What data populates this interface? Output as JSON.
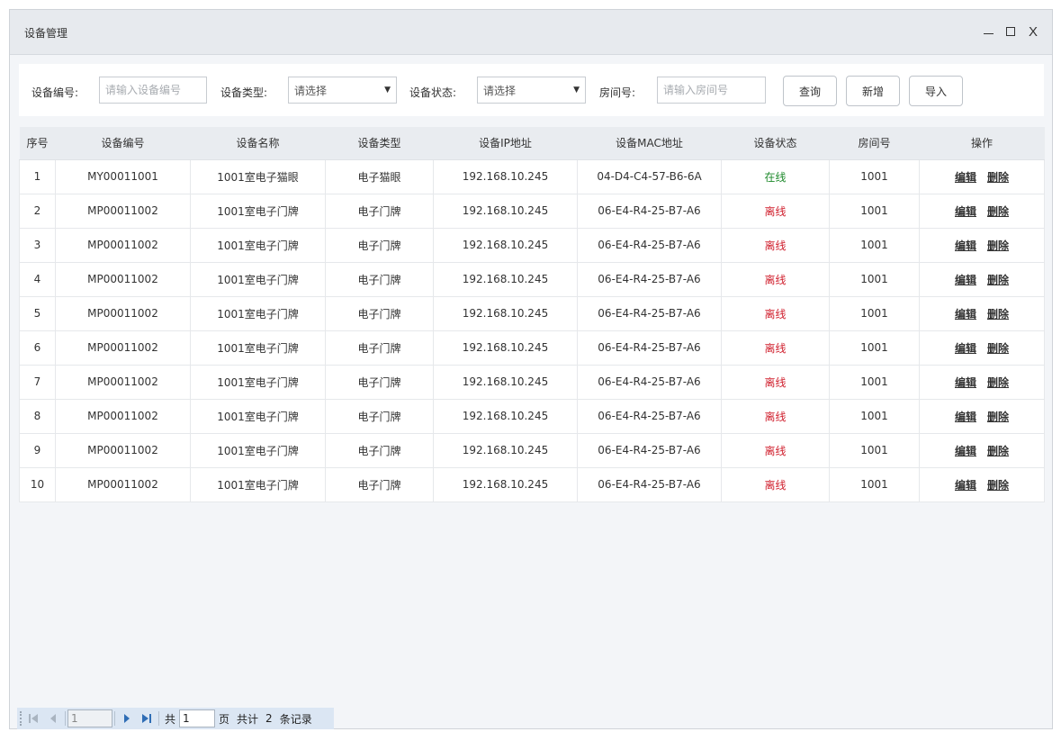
{
  "window": {
    "title": "设备管理",
    "close_label": "X"
  },
  "filters": {
    "device_no_label": "设备编号:",
    "device_no_placeholder": "请输入设备编号",
    "device_type_label": "设备类型:",
    "device_type_value": "请选择",
    "device_status_label": "设备状态:",
    "device_status_value": "请选择",
    "room_label": "房间号:",
    "room_placeholder": "请输入房间号",
    "query_button": "查询",
    "add_button": "新增",
    "import_button": "导入"
  },
  "table": {
    "headers": [
      "序号",
      "设备编号",
      "设备名称",
      "设备类型",
      "设备IP地址",
      "设备MAC地址",
      "设备状态",
      "房间号",
      "操作"
    ],
    "edit_label": "编辑",
    "delete_label": "删除",
    "rows": [
      {
        "index": "1",
        "device_no": "MY00011001",
        "name": "1001室电子猫眼",
        "type": "电子猫眼",
        "ip": "192.168.10.245",
        "mac": "04-D4-C4-57-B6-6A",
        "status": "在线",
        "status_color": "#1f8a2c",
        "room": "1001"
      },
      {
        "index": "2",
        "device_no": "MP00011002",
        "name": "1001室电子门牌",
        "type": "电子门牌",
        "ip": "192.168.10.245",
        "mac": "06-E4-R4-25-B7-A6",
        "status": "离线",
        "status_color": "#d0202e",
        "room": "1001"
      },
      {
        "index": "3",
        "device_no": "MP00011002",
        "name": "1001室电子门牌",
        "type": "电子门牌",
        "ip": "192.168.10.245",
        "mac": "06-E4-R4-25-B7-A6",
        "status": "离线",
        "status_color": "#d0202e",
        "room": "1001"
      },
      {
        "index": "4",
        "device_no": "MP00011002",
        "name": "1001室电子门牌",
        "type": "电子门牌",
        "ip": "192.168.10.245",
        "mac": "06-E4-R4-25-B7-A6",
        "status": "离线",
        "status_color": "#d0202e",
        "room": "1001"
      },
      {
        "index": "5",
        "device_no": "MP00011002",
        "name": "1001室电子门牌",
        "type": "电子门牌",
        "ip": "192.168.10.245",
        "mac": "06-E4-R4-25-B7-A6",
        "status": "离线",
        "status_color": "#d0202e",
        "room": "1001"
      },
      {
        "index": "6",
        "device_no": "MP00011002",
        "name": "1001室电子门牌",
        "type": "电子门牌",
        "ip": "192.168.10.245",
        "mac": "06-E4-R4-25-B7-A6",
        "status": "离线",
        "status_color": "#d0202e",
        "room": "1001"
      },
      {
        "index": "7",
        "device_no": "MP00011002",
        "name": "1001室电子门牌",
        "type": "电子门牌",
        "ip": "192.168.10.245",
        "mac": "06-E4-R4-25-B7-A6",
        "status": "离线",
        "status_color": "#d0202e",
        "room": "1001"
      },
      {
        "index": "8",
        "device_no": "MP00011002",
        "name": "1001室电子门牌",
        "type": "电子门牌",
        "ip": "192.168.10.245",
        "mac": "06-E4-R4-25-B7-A6",
        "status": "离线",
        "status_color": "#d0202e",
        "room": "1001"
      },
      {
        "index": "9",
        "device_no": "MP00011002",
        "name": "1001室电子门牌",
        "type": "电子门牌",
        "ip": "192.168.10.245",
        "mac": "06-E4-R4-25-B7-A6",
        "status": "离线",
        "status_color": "#d0202e",
        "room": "1001"
      },
      {
        "index": "10",
        "device_no": "MP00011002",
        "name": "1001室电子门牌",
        "type": "电子门牌",
        "ip": "192.168.10.245",
        "mac": "06-E4-R4-25-B7-A6",
        "status": "离线",
        "status_color": "#d0202e",
        "room": "1001"
      }
    ]
  },
  "pager": {
    "current_page": "1",
    "total_pages_prefix": "共",
    "total_pages": "1",
    "page_suffix": "页",
    "total_prefix": "共计",
    "total_count": "2",
    "records_suffix": "条记录"
  }
}
